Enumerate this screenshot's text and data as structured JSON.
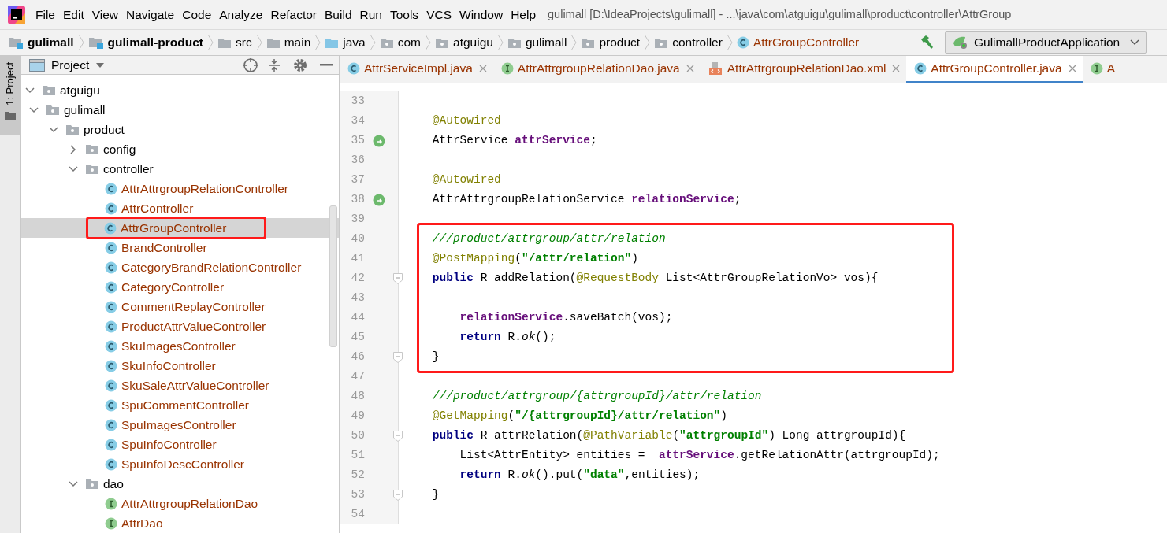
{
  "title_bar": {
    "menu": [
      "File",
      "Edit",
      "View",
      "Navigate",
      "Code",
      "Analyze",
      "Refactor",
      "Build",
      "Run",
      "Tools",
      "VCS",
      "Window",
      "Help"
    ],
    "title": "gulimall [D:\\IdeaProjects\\gulimall] - ...\\java\\com\\atguigu\\gulimall\\product\\controller\\AttrGroup"
  },
  "breadcrumbs": [
    {
      "label": "gulimall",
      "kind": "module"
    },
    {
      "label": "gulimall-product",
      "kind": "module"
    },
    {
      "label": "src",
      "kind": "folder"
    },
    {
      "label": "main",
      "kind": "folder"
    },
    {
      "label": "java",
      "kind": "source"
    },
    {
      "label": "com",
      "kind": "package"
    },
    {
      "label": "atguigu",
      "kind": "package"
    },
    {
      "label": "gulimall",
      "kind": "package"
    },
    {
      "label": "product",
      "kind": "package"
    },
    {
      "label": "controller",
      "kind": "package"
    },
    {
      "label": "AttrGroupController",
      "kind": "class"
    }
  ],
  "run_config": {
    "label": "GulimallProductApplication"
  },
  "tool_window": {
    "stripe_tab": "1: Project",
    "title": "Project",
    "tree": [
      {
        "label": "atguigu",
        "kind": "package",
        "expanded": true,
        "selected": false,
        "highlighted": false,
        "children": [
          {
            "label": "gulimall",
            "kind": "package",
            "expanded": true,
            "selected": false,
            "highlighted": false,
            "children": [
              {
                "label": "product",
                "kind": "package",
                "expanded": true,
                "selected": false,
                "highlighted": false,
                "children": [
                  {
                    "label": "config",
                    "kind": "package",
                    "expanded": false,
                    "selected": false,
                    "highlighted": false
                  },
                  {
                    "label": "controller",
                    "kind": "package",
                    "expanded": true,
                    "selected": false,
                    "highlighted": false,
                    "children": [
                      {
                        "label": "AttrAttrgroupRelationController",
                        "kind": "class",
                        "selected": false,
                        "highlighted": false
                      },
                      {
                        "label": "AttrController",
                        "kind": "class",
                        "selected": false,
                        "highlighted": false
                      },
                      {
                        "label": "AttrGroupController",
                        "kind": "class",
                        "selected": true,
                        "highlighted": true
                      },
                      {
                        "label": "BrandController",
                        "kind": "class",
                        "selected": false,
                        "highlighted": false
                      },
                      {
                        "label": "CategoryBrandRelationController",
                        "kind": "class",
                        "selected": false,
                        "highlighted": false
                      },
                      {
                        "label": "CategoryController",
                        "kind": "class",
                        "selected": false,
                        "highlighted": false
                      },
                      {
                        "label": "CommentReplayController",
                        "kind": "class",
                        "selected": false,
                        "highlighted": false
                      },
                      {
                        "label": "ProductAttrValueController",
                        "kind": "class",
                        "selected": false,
                        "highlighted": false
                      },
                      {
                        "label": "SkuImagesController",
                        "kind": "class",
                        "selected": false,
                        "highlighted": false
                      },
                      {
                        "label": "SkuInfoController",
                        "kind": "class",
                        "selected": false,
                        "highlighted": false
                      },
                      {
                        "label": "SkuSaleAttrValueController",
                        "kind": "class",
                        "selected": false,
                        "highlighted": false
                      },
                      {
                        "label": "SpuCommentController",
                        "kind": "class",
                        "selected": false,
                        "highlighted": false
                      },
                      {
                        "label": "SpuImagesController",
                        "kind": "class",
                        "selected": false,
                        "highlighted": false
                      },
                      {
                        "label": "SpuInfoController",
                        "kind": "class",
                        "selected": false,
                        "highlighted": false
                      },
                      {
                        "label": "SpuInfoDescController",
                        "kind": "class",
                        "selected": false,
                        "highlighted": false
                      }
                    ]
                  },
                  {
                    "label": "dao",
                    "kind": "package",
                    "expanded": true,
                    "selected": false,
                    "highlighted": false,
                    "children": [
                      {
                        "label": "AttrAttrgroupRelationDao",
                        "kind": "interface",
                        "selected": false,
                        "highlighted": false
                      },
                      {
                        "label": "AttrDao",
                        "kind": "interface",
                        "selected": false,
                        "highlighted": false
                      }
                    ]
                  }
                ]
              }
            ]
          }
        ]
      }
    ]
  },
  "editor": {
    "tabs": [
      {
        "label": "AttrServiceImpl.java",
        "kind": "class",
        "selected": false
      },
      {
        "label": "AttrAttrgroupRelationDao.java",
        "kind": "interface",
        "selected": false
      },
      {
        "label": "AttrAttrgroupRelationDao.xml",
        "kind": "xml",
        "selected": false
      },
      {
        "label": "AttrGroupController.java",
        "kind": "class",
        "selected": true
      },
      {
        "label": "A",
        "kind": "interface",
        "selected": false
      }
    ],
    "blocks": [
      {
        "highlighted": false,
        "lines": [
          {
            "number": "33",
            "kind": "plain"
          },
          {
            "number": "34",
            "kind": "plain",
            "tokens": [
              {
                "kind": "annotation",
                "text": "    @Autowired"
              }
            ]
          },
          {
            "number": "35",
            "kind": "bean",
            "tokens": [
              {
                "kind": "plain",
                "text": "    AttrService "
              },
              {
                "kind": "field",
                "text": "attrService"
              },
              {
                "kind": "plain",
                "text": ";"
              }
            ]
          },
          {
            "number": "36",
            "kind": "plain"
          },
          {
            "number": "37",
            "kind": "plain",
            "tokens": [
              {
                "kind": "annotation",
                "text": "    @Autowired"
              }
            ]
          },
          {
            "number": "38",
            "kind": "bean",
            "tokens": [
              {
                "kind": "plain",
                "text": "    AttrAttrgroupRelationService "
              },
              {
                "kind": "field",
                "text": "relationService"
              },
              {
                "kind": "plain",
                "text": ";"
              }
            ]
          },
          {
            "number": "39",
            "kind": "plain"
          }
        ]
      },
      {
        "highlighted": true,
        "lines": [
          {
            "number": "40",
            "kind": "plain",
            "tokens": [
              {
                "kind": "comment",
                "text": "    ///product/attrgroup/attr/relation"
              }
            ]
          },
          {
            "number": "41",
            "kind": "plain",
            "tokens": [
              {
                "kind": "annotation",
                "text": "    @PostMapping"
              },
              {
                "kind": "plain",
                "text": "("
              },
              {
                "kind": "string",
                "text": "\"/attr/relation\""
              },
              {
                "kind": "plain",
                "text": ")"
              }
            ]
          },
          {
            "number": "42",
            "kind": "fold",
            "tokens": [
              {
                "kind": "keyword",
                "text": "    public"
              },
              {
                "kind": "plain",
                "text": " R addRelation("
              },
              {
                "kind": "annotation",
                "text": "@RequestBody"
              },
              {
                "kind": "plain",
                "text": " List<AttrGroupRelationVo> vos){"
              }
            ]
          },
          {
            "number": "43",
            "kind": "plain"
          },
          {
            "number": "44",
            "kind": "plain",
            "tokens": [
              {
                "kind": "field",
                "text": "        relationService"
              },
              {
                "kind": "plain",
                "text": ".saveBatch(vos);"
              }
            ]
          },
          {
            "number": "45",
            "kind": "plain",
            "tokens": [
              {
                "kind": "keyword",
                "text": "        return"
              },
              {
                "kind": "plain",
                "text": " R."
              },
              {
                "kind": "static",
                "text": "ok"
              },
              {
                "kind": "plain",
                "text": "();"
              }
            ]
          },
          {
            "number": "46",
            "kind": "fold",
            "tokens": [
              {
                "kind": "plain",
                "text": "    }"
              }
            ]
          }
        ]
      },
      {
        "highlighted": false,
        "lines": [
          {
            "number": "47",
            "kind": "plain"
          },
          {
            "number": "48",
            "kind": "plain",
            "tokens": [
              {
                "kind": "comment",
                "text": "    ///product/attrgroup/{attrgroupId}/attr/relation"
              }
            ]
          },
          {
            "number": "49",
            "kind": "plain",
            "tokens": [
              {
                "kind": "annotation",
                "text": "    @GetMapping"
              },
              {
                "kind": "plain",
                "text": "("
              },
              {
                "kind": "string",
                "text": "\"/{attrgroupId}/attr/relation\""
              },
              {
                "kind": "plain",
                "text": ")"
              }
            ]
          },
          {
            "number": "50",
            "kind": "fold",
            "tokens": [
              {
                "kind": "keyword",
                "text": "    public"
              },
              {
                "kind": "plain",
                "text": " R attrRelation("
              },
              {
                "kind": "annotation",
                "text": "@PathVariable"
              },
              {
                "kind": "plain",
                "text": "("
              },
              {
                "kind": "string",
                "text": "\"attrgroupId\""
              },
              {
                "kind": "plain",
                "text": ") Long attrgroupId){"
              }
            ]
          },
          {
            "number": "51",
            "kind": "plain",
            "tokens": [
              {
                "kind": "plain",
                "text": "        List<AttrEntity> entities =  "
              },
              {
                "kind": "field",
                "text": "attrService"
              },
              {
                "kind": "plain",
                "text": ".getRelationAttr(attrgroupId);"
              }
            ]
          },
          {
            "number": "52",
            "kind": "plain",
            "tokens": [
              {
                "kind": "keyword",
                "text": "        return"
              },
              {
                "kind": "plain",
                "text": " R."
              },
              {
                "kind": "static",
                "text": "ok"
              },
              {
                "kind": "plain",
                "text": "().put("
              },
              {
                "kind": "string",
                "text": "\"data\""
              },
              {
                "kind": "plain",
                "text": ",entities);"
              }
            ]
          },
          {
            "number": "53",
            "kind": "fold",
            "tokens": [
              {
                "kind": "plain",
                "text": "    }"
              }
            ]
          },
          {
            "number": "54",
            "kind": "plain"
          }
        ]
      }
    ]
  }
}
